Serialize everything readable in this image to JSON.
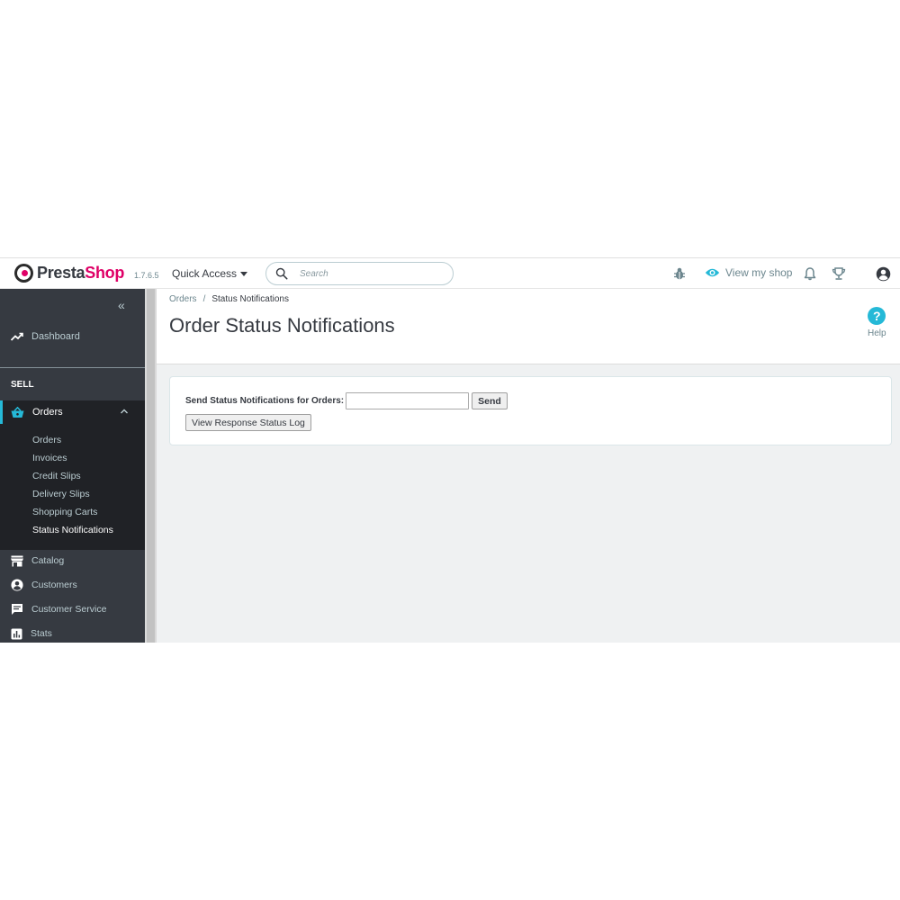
{
  "header": {
    "logo_part1": "Presta",
    "logo_part2": "Shop",
    "version": "1.7.6.5",
    "quick_access": "Quick Access",
    "search_placeholder": "Search",
    "view_shop": "View my shop",
    "icons": [
      "bug-icon",
      "eye-icon",
      "bell-icon",
      "trophy-icon",
      "user-icon"
    ]
  },
  "sidebar": {
    "collapse_label": "«",
    "dashboard": "Dashboard",
    "section": "SELL",
    "orders": {
      "label": "Orders",
      "items": [
        "Orders",
        "Invoices",
        "Credit Slips",
        "Delivery Slips",
        "Shopping Carts",
        "Status Notifications"
      ],
      "active_index": 5
    },
    "items": [
      "Catalog",
      "Customers",
      "Customer Service",
      "Stats"
    ]
  },
  "page": {
    "breadcrumb_parent": "Orders",
    "breadcrumb_sep": "/",
    "breadcrumb_current": "Status Notifications",
    "title": "Order Status Notifications",
    "help_label": "Help"
  },
  "form": {
    "label": "Send Status Notifications for Orders:",
    "input_value": "",
    "send_label": "Send",
    "log_label": "View Response Status Log"
  },
  "colors": {
    "accent": "#25b9d7",
    "brand_pink": "#df0067",
    "sidebar_bg": "#363a41",
    "sidebar_active_bg": "#202226",
    "content_bg": "#eff1f2"
  }
}
